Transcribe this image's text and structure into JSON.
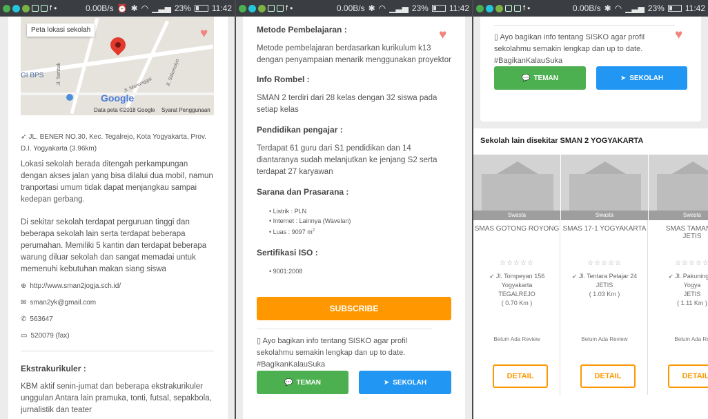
{
  "status_bar": {
    "speed": "0.00B/s",
    "battery": "23%",
    "time": "11:42"
  },
  "panel1": {
    "map": {
      "label": "Peta lokasi sekolah",
      "google": "Google",
      "data": "Data peta ©2018 Google",
      "terms": "Syarat Penggunaan",
      "place": "GI BPS",
      "street1": "Jl. Tambak",
      "street2": "Jl. Manunggal",
      "street3": "Jl. Sidomulyo"
    },
    "address": "JL. BENER NO.30, Kec. Tegalrejo, Kota Yogyakarta, Prov. D.I. Yogyakarta (3.96km)",
    "desc1": "Lokasi sekolah berada ditengah perkampungan dengan akses jalan yang bisa dilalui dua mobil, namun tranportasi umum tidak dapat menjangkau sampai kedepan gerbang.",
    "desc2": "Di sekitar sekolah terdapat perguruan tinggi dan beberapa sekolah lain serta terdapat beberapa perumahan. Memiliki 5 kantin dan terdapat beberapa warung diluar sekolah dan sangat memadai untuk memenuhi kebutuhan makan siang siswa",
    "website": "http://www.sman2jogja.sch.id/",
    "email": "sman2yk@gmail.com",
    "phone": "563647",
    "fax": "520079 (fax)",
    "ekstra_title": "Ekstrakurikuler :",
    "ekstra_text": "KBM aktif senin-jumat dan beberapa ekstrakurikuler unggulan Antara lain pramuka, tonti, futsal, sepakbola, jurnalistik dan teater"
  },
  "panel2": {
    "metode_title": "Metode Pembelajaran :",
    "metode_text": "Metode pembelajaran berdasarkan kurikulum k13 dengan penyampaian menarik menggunakan proyektor",
    "rombel_title": "Info Rombel :",
    "rombel_text": "SMAN 2 terdiri dari 28 kelas dengan 32 siswa pada setiap kelas",
    "pengajar_title": "Pendidikan pengajar :",
    "pengajar_text": "Terdapat 61 guru dari S1 pendidikan dan 14 diantaranya sudah melanjutkan ke jenjang S2 serta terdapat 27 karyawan",
    "sarana_title": "Sarana dan Prasarana :",
    "sarana_items": [
      "Listrik : PLN",
      "Internet : Lainnya (Wavelan)",
      "Luas : 9097 m"
    ],
    "iso_title": "Sertifikasi ISO :",
    "iso_items": [
      "9001:2008"
    ],
    "subscribe": "SUBSCRIBE",
    "share_text": "Ayo bagikan info tentang SISKO agar profil sekolahmu semakin lengkap dan up to date. #BagikanKalauSuka",
    "teman": "TEMAN",
    "sekolah": "SEKOLAH"
  },
  "panel3": {
    "share_text": "Ayo bagikan info tentang SISKO agar profil sekolahmu semakin lengkap dan up to date. #BagikanKalauSuka",
    "teman": "TEMAN",
    "sekolah": "SEKOLAH",
    "nearby_title": "Sekolah lain disekitar SMAN 2 YOGYAKARTA",
    "schools": [
      {
        "name": "SMAS GOTONG ROYONG",
        "type": "Swasta",
        "stars": "☆☆☆☆☆",
        "addr1": "Jl. Tompeyan 156",
        "addr2": "Yogyakarta",
        "addr3": "TEGALREJO",
        "dist": "( 0.70 Km )",
        "review": "Belum Ada Review",
        "detail": "DETAIL"
      },
      {
        "name": "SMAS 17-1 YOGYAKARTA",
        "type": "Swasta",
        "stars": "☆☆☆☆☆",
        "addr1": "Jl. Tentara Pelajar 24",
        "addr2": "JETIS",
        "addr3": "",
        "dist": "( 1.03 Km )",
        "review": "Belum Ada Review",
        "detail": "DETAIL"
      },
      {
        "name": "SMAS TAMAN M JETIS",
        "type": "Swasta",
        "stars": "☆☆☆☆☆",
        "addr1": "Jl. Pakuningrat",
        "addr2": "Yogya",
        "addr3": "JETIS",
        "dist": "( 1.11 Km )",
        "review": "Belum Ada Re",
        "detail": "DETAIL"
      }
    ]
  }
}
